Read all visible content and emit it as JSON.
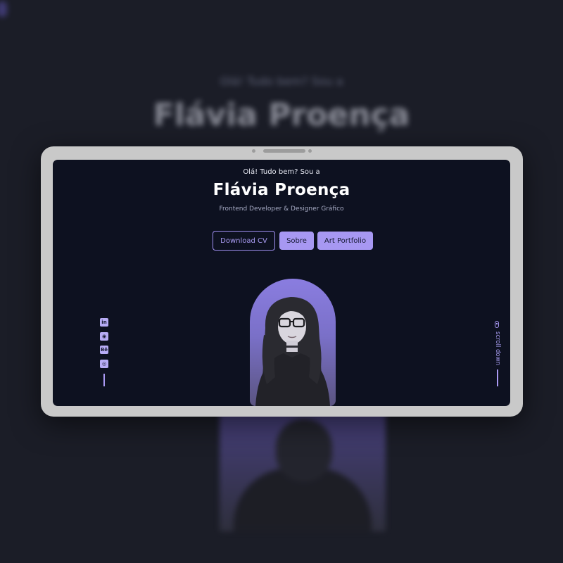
{
  "hero": {
    "greeting": "Olá! Tudo bem? Sou a",
    "name": "Flávia Proença",
    "role": "Frontend Developer & Designer Gráfico"
  },
  "buttons": {
    "download_cv": "Download CV",
    "sobre": "Sobre",
    "art_portfolio": "Art Portfolio"
  },
  "socials": [
    {
      "icon": "linkedin-icon",
      "glyph": "in"
    },
    {
      "icon": "github-icon",
      "glyph": "◉"
    },
    {
      "icon": "behance-icon",
      "glyph": "Bē"
    },
    {
      "icon": "instagram-icon",
      "glyph": "◎"
    }
  ],
  "scroll": {
    "label": "scroll down",
    "icon": "mouse-icon"
  },
  "colors": {
    "background": "#0d1120",
    "accent": "#a798f2",
    "text": "#ffffff",
    "muted": "#a7abc4",
    "device_frame": "#c9c9c9"
  }
}
